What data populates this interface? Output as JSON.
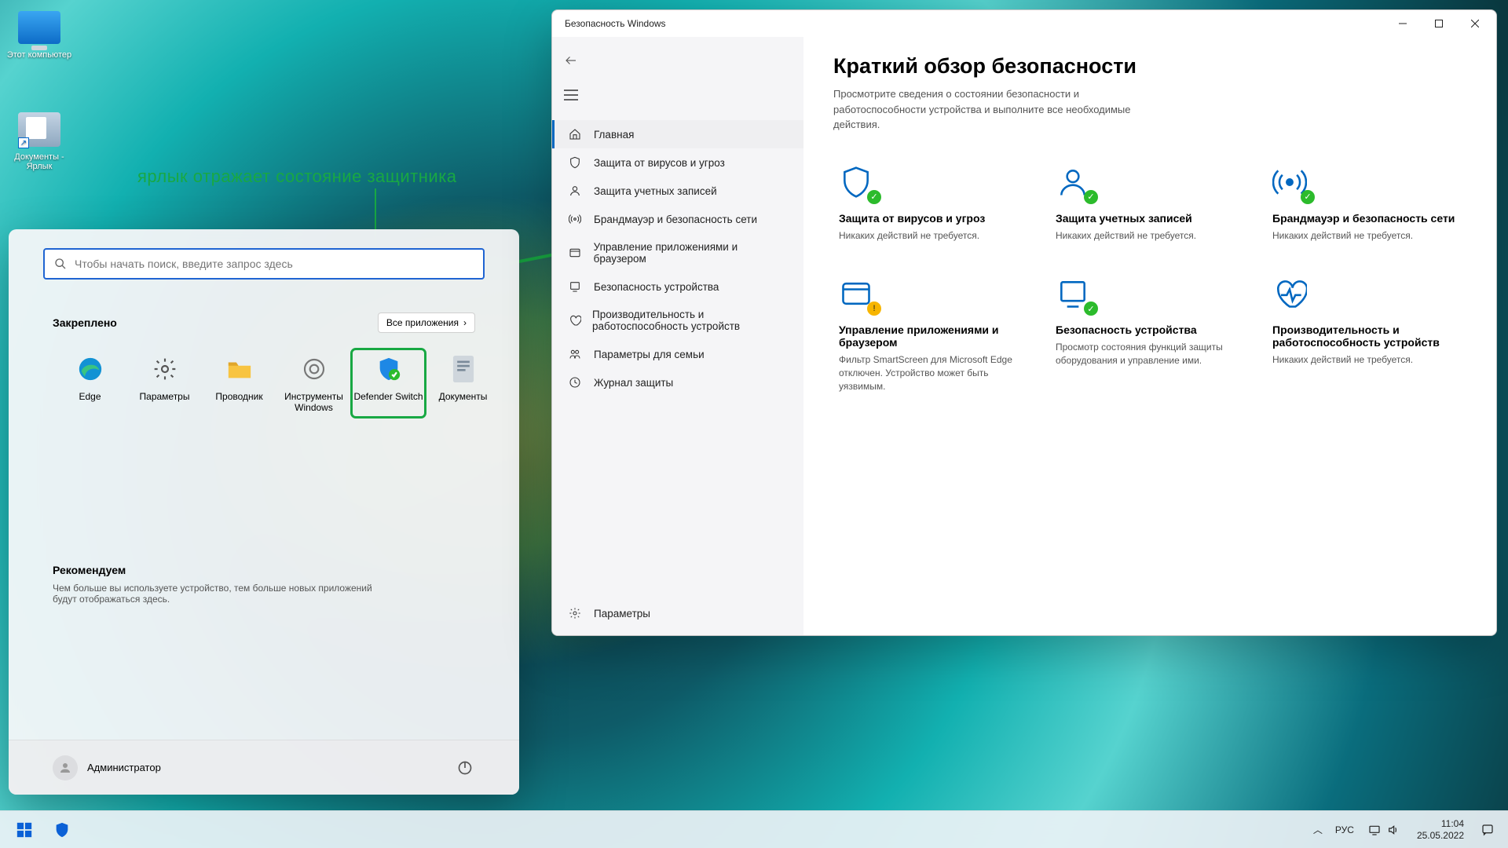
{
  "desktop": {
    "this_pc": "Этот компьютер",
    "documents_shortcut": "Документы -\nЯрлык"
  },
  "annotation": {
    "text": "ярлык отражает состояние защитника"
  },
  "start_menu": {
    "search_placeholder": "Чтобы начать поиск, введите запрос здесь",
    "pinned_header": "Закреплено",
    "all_apps": "Все приложения",
    "pinned": [
      {
        "label": "Edge",
        "icon": "edge"
      },
      {
        "label": "Параметры",
        "icon": "gear"
      },
      {
        "label": "Проводник",
        "icon": "folder"
      },
      {
        "label": "Инструменты Windows",
        "icon": "tools"
      },
      {
        "label": "Defender Switch",
        "icon": "shield-check"
      },
      {
        "label": "Документы",
        "icon": "doc"
      }
    ],
    "recommended_header": "Рекомендуем",
    "recommended_body": "Чем больше вы используете устройство, тем больше новых приложений будут отображаться здесь.",
    "user": "Администратор"
  },
  "security_window": {
    "title": "Безопасность Windows",
    "nav": [
      {
        "label": "Главная",
        "icon": "home",
        "active": true
      },
      {
        "label": "Защита от вирусов и угроз",
        "icon": "shield"
      },
      {
        "label": "Защита учетных записей",
        "icon": "user"
      },
      {
        "label": "Брандмауэр и безопасность сети",
        "icon": "antenna"
      },
      {
        "label": "Управление приложениями и браузером",
        "icon": "window"
      },
      {
        "label": "Безопасность устройства",
        "icon": "device"
      },
      {
        "label": "Производительность и работоспособность устройств",
        "icon": "heart"
      },
      {
        "label": "Параметры для семьи",
        "icon": "family"
      },
      {
        "label": "Журнал защиты",
        "icon": "history"
      }
    ],
    "nav_settings": "Параметры",
    "heading": "Краткий обзор безопасности",
    "subtitle": "Просмотрите сведения о состоянии безопасности и работоспособности устройства и выполните все необходимые действия.",
    "tiles": [
      {
        "title": "Защита от вирусов и угроз",
        "desc": "Никаких действий не требуется.",
        "icon": "shield",
        "status": "ok"
      },
      {
        "title": "Защита учетных записей",
        "desc": "Никаких действий не требуется.",
        "icon": "user",
        "status": "ok"
      },
      {
        "title": "Брандмауэр и безопасность сети",
        "desc": "Никаких действий не требуется.",
        "icon": "antenna",
        "status": "ok"
      },
      {
        "title": "Управление приложениями и браузером",
        "desc": "Фильтр SmartScreen для Microsoft Edge отключен. Устройство может быть уязвимым.",
        "icon": "window",
        "status": "warn"
      },
      {
        "title": "Безопасность устройства",
        "desc": "Просмотр состояния функций защиты оборудования и управление ими.",
        "icon": "device",
        "status": "ok"
      },
      {
        "title": "Производительность и работоспособность устройств",
        "desc": "Никаких действий не требуется.",
        "icon": "heart",
        "status": "none"
      }
    ]
  },
  "taskbar": {
    "lang": "РУС",
    "time": "11:04",
    "date": "25.05.2022"
  }
}
